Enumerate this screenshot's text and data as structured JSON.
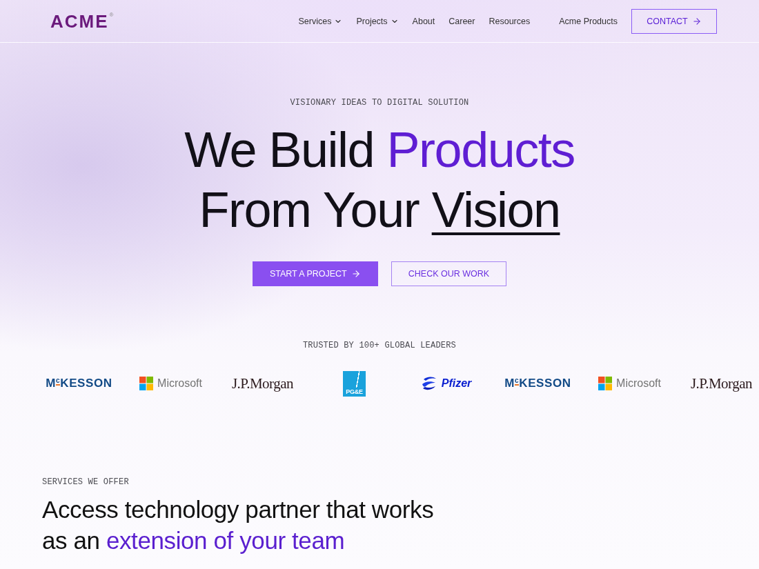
{
  "header": {
    "logo": {
      "text": "ACME",
      "mark": "®"
    },
    "nav": [
      {
        "label": "Services",
        "has_menu": true
      },
      {
        "label": "Projects",
        "has_menu": true
      },
      {
        "label": "About",
        "has_menu": false
      },
      {
        "label": "Career",
        "has_menu": false
      },
      {
        "label": "Resources",
        "has_menu": false
      }
    ],
    "products_link": "Acme Products",
    "contact_button": {
      "label": "CONTACT",
      "arrow": true
    }
  },
  "hero": {
    "eyebrow": "VISIONARY IDEAS TO DIGITAL SOLUTION",
    "headline": [
      [
        {
          "text": "We Build",
          "kind": "plain"
        },
        {
          "text": "Products",
          "kind": "accent"
        }
      ],
      [
        {
          "text": "From Your",
          "kind": "plain"
        },
        {
          "text": "Vision",
          "kind": "underline"
        }
      ]
    ],
    "buttons": [
      {
        "label": "START A PROJECT",
        "kind": "primary",
        "arrow": true
      },
      {
        "label": "CHECK OUR WORK",
        "kind": "outline",
        "arrow": false
      }
    ]
  },
  "clients": {
    "title": "TRUSTED BY 100+ GLOBAL LEADERS",
    "logos": [
      {
        "kind": "mckesson",
        "text": "M$^{c}$KESSON"
      },
      {
        "kind": "microsoft",
        "text": "Microsoft"
      },
      {
        "kind": "jpmorgan",
        "text": "J.P.Morgan"
      },
      {
        "kind": "pge",
        "text": "PG&E"
      },
      {
        "kind": "pfizer",
        "text": "Pfizer"
      },
      {
        "kind": "mckesson",
        "text": "M$^{c}$KESSON"
      },
      {
        "kind": "microsoft",
        "text": "Microsoft"
      },
      {
        "kind": "jpmorgan",
        "text": "J.P.Morgan"
      }
    ]
  },
  "services": {
    "eyebrow": "SERVICES WE OFFER",
    "heading": [
      [
        {
          "text": "Access technology partner that works",
          "kind": "plain"
        }
      ],
      [
        {
          "text": "as an",
          "kind": "plain"
        },
        {
          "text": "extension of your team",
          "kind": "accent"
        }
      ]
    ]
  }
}
